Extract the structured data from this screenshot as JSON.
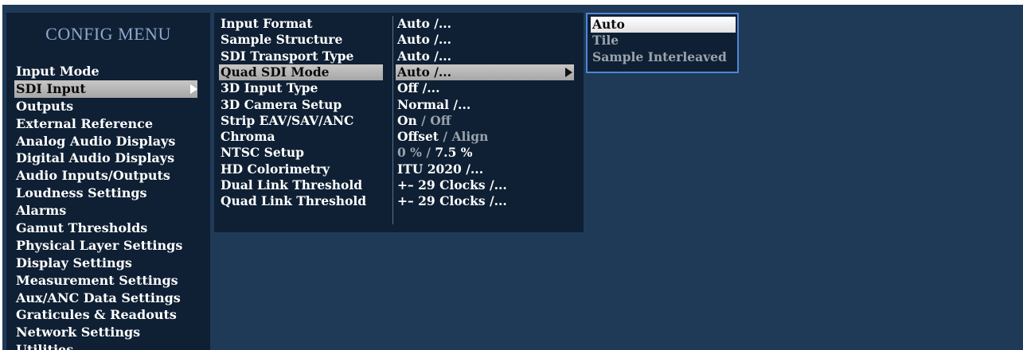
{
  "config_menu": {
    "title": "CONFIG MENU",
    "items": [
      {
        "label": "Input Mode"
      },
      {
        "label": "SDI Input",
        "selected": true
      },
      {
        "label": "Outputs"
      },
      {
        "label": "External Reference"
      },
      {
        "label": "Analog Audio Displays"
      },
      {
        "label": "Digital Audio Displays"
      },
      {
        "label": "Audio Inputs/Outputs"
      },
      {
        "label": "Loudness Settings"
      },
      {
        "label": "Alarms"
      },
      {
        "label": "Gamut Thresholds"
      },
      {
        "label": "Physical Layer Settings"
      },
      {
        "label": "Display Settings"
      },
      {
        "label": "Measurement Settings"
      },
      {
        "label": "Aux/ANC Data Settings"
      },
      {
        "label": "Graticules & Readouts"
      },
      {
        "label": "Network Settings"
      },
      {
        "label": "Utilities"
      }
    ]
  },
  "sdi_input": {
    "rows": [
      {
        "label": "Input Format",
        "value": "Auto /..."
      },
      {
        "label": "Sample Structure",
        "value": "Auto /..."
      },
      {
        "label": "SDI Transport Type",
        "value": "Auto /..."
      },
      {
        "label": "Quad SDI Mode",
        "value": "Auto /...",
        "selected": true
      },
      {
        "label": "3D Input Type",
        "value": "Off /..."
      },
      {
        "label": "3D Camera Setup",
        "value": "Normal /..."
      },
      {
        "label": "Strip EAV/SAV/ANC",
        "value_on": "On",
        "value_sep": " / ",
        "value_off": "Off"
      },
      {
        "label": "Chroma",
        "value_on": "Offset",
        "value_sep": " / ",
        "value_off": "Align"
      },
      {
        "label": "NTSC Setup",
        "value_off": "0 %",
        "value_sep": " / ",
        "value_on": "7.5 %"
      },
      {
        "label": "HD Colorimetry",
        "value": "ITU 2020 /..."
      },
      {
        "label": "Dual Link Threshold",
        "value": "+– 29 Clocks /..."
      },
      {
        "label": "Quad Link Threshold",
        "value": "+– 29 Clocks /..."
      }
    ]
  },
  "quad_sdi_options": [
    {
      "label": "Auto",
      "selected": true
    },
    {
      "label": "Tile"
    },
    {
      "label": "Sample Interleaved"
    }
  ],
  "colors": {
    "background": "#1f3a57",
    "panel": "#0f2034",
    "highlight": "#b5b5b5",
    "option_border": "#4f86d9",
    "title": "#8ea8cc",
    "dim_text": "#9aa3ad"
  }
}
